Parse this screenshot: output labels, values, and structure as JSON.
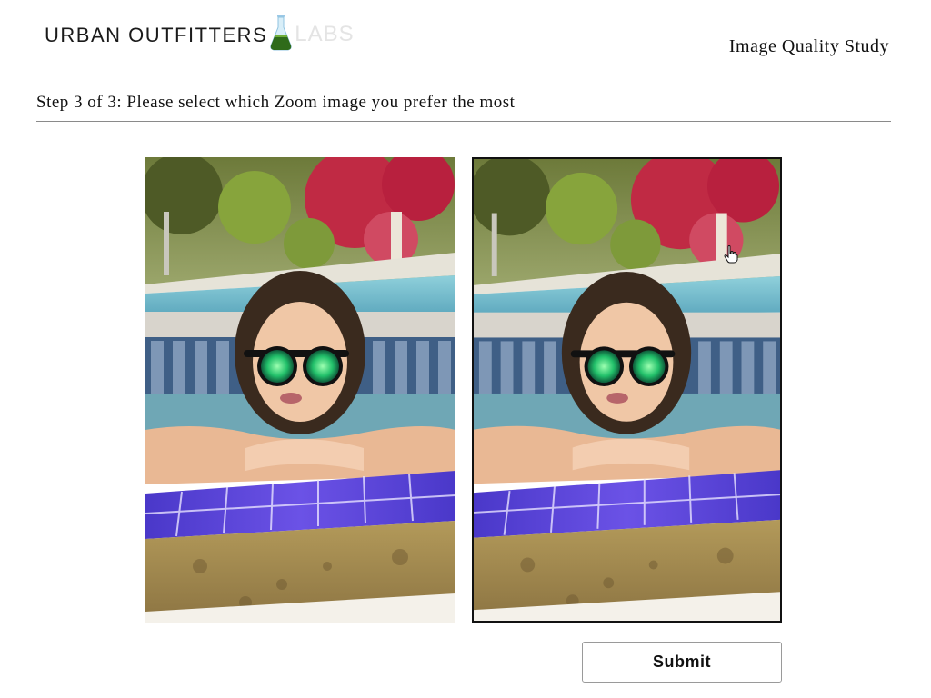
{
  "header": {
    "logo_brand": "URBAN OUTFITTERS",
    "logo_suffix": "LABS",
    "logo_icon": "flask-icon",
    "study_title": "Image Quality Study"
  },
  "step": {
    "title": "Step 3 of 3: Please select which Zoom image you prefer the most"
  },
  "options": [
    {
      "id": "a",
      "selected": false,
      "image": "woman-in-pool-sunglasses-photo"
    },
    {
      "id": "b",
      "selected": true,
      "image": "woman-in-pool-sunglasses-photo"
    }
  ],
  "submit": {
    "label": "Submit"
  },
  "colors": {
    "text": "#111111",
    "divider": "#8a8a8a",
    "selected_border": "#111111",
    "labs_text": "#e4e4e4",
    "flask_liquid": "#2f6b1a"
  }
}
